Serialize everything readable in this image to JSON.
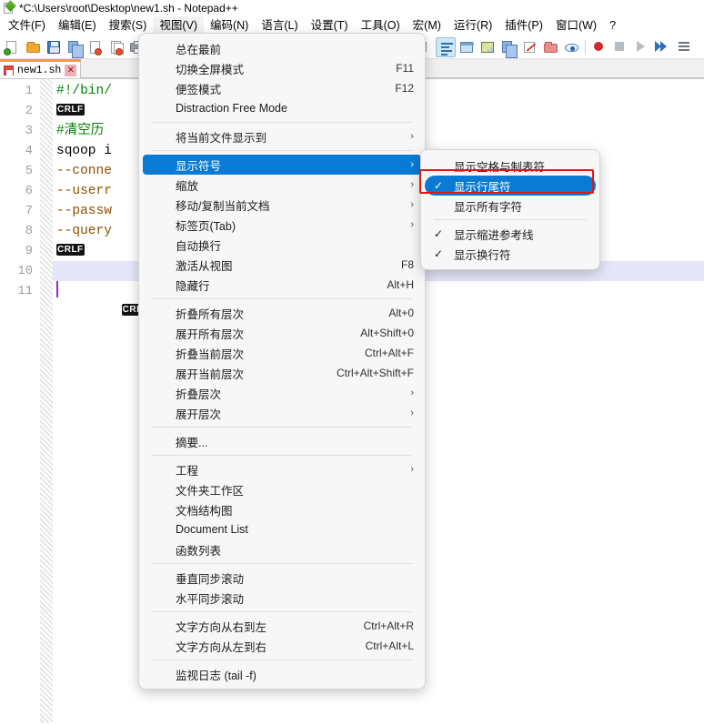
{
  "window": {
    "title": "*C:\\Users\\root\\Desktop\\new1.sh - Notepad++",
    "app_icon": "notepad-plus-plus-icon"
  },
  "menubar": {
    "items": [
      {
        "label": "文件(F)",
        "active": false
      },
      {
        "label": "编辑(E)",
        "active": false
      },
      {
        "label": "搜索(S)",
        "active": false
      },
      {
        "label": "视图(V)",
        "active": true
      },
      {
        "label": "编码(N)",
        "active": false
      },
      {
        "label": "语言(L)",
        "active": false
      },
      {
        "label": "设置(T)",
        "active": false
      },
      {
        "label": "工具(O)",
        "active": false
      },
      {
        "label": "宏(M)",
        "active": false
      },
      {
        "label": "运行(R)",
        "active": false
      },
      {
        "label": "插件(P)",
        "active": false
      },
      {
        "label": "窗口(W)",
        "active": false
      },
      {
        "label": "?",
        "active": false
      }
    ]
  },
  "toolbar": {
    "buttons": [
      "new-file-icon",
      "open-file-icon",
      "save-icon",
      "save-all-icon",
      "close-file-icon",
      "close-all-icon",
      "print-icon",
      "sep",
      "cut-icon",
      "copy-icon",
      "paste-icon",
      "sep",
      "undo-icon",
      "redo-icon",
      "sep",
      "find-icon",
      "replace-icon",
      "sep",
      "zoom-in-icon",
      "zoom-out-icon",
      "sep",
      "sync-scroll-icon",
      "word-wrap-icon",
      "show-all-chars-icon",
      "show-symbol-icon",
      "indent-guide-icon",
      "ui-map-icon",
      "clone-doc-icon",
      "marker-icon",
      "folder-as-workspace-icon",
      "monitor-icon",
      "sep",
      "record-macro-icon",
      "stop-macro-icon",
      "play-macro-icon",
      "run-macro-multi-icon",
      "run-icon"
    ],
    "active_button": "show-symbol-icon"
  },
  "tabs": {
    "items": [
      {
        "label": "new1.sh",
        "icon": "modified-file-icon",
        "close": "✕",
        "active": true
      }
    ]
  },
  "editor": {
    "line_numbers": [
      "1",
      "2",
      "3",
      "4",
      "5",
      "6",
      "7",
      "8",
      "9",
      "10",
      "11"
    ],
    "current_line": 10,
    "eol_marker": "CRLF",
    "lines": [
      {
        "n": 1,
        "segments": [
          {
            "text": "#!/bin/",
            "style": "comment"
          }
        ]
      },
      {
        "n": 2,
        "segments": [
          {
            "text": "",
            "style": "plain"
          }
        ],
        "eol": true
      },
      {
        "n": 3,
        "segments": [
          {
            "text": "#清空历",
            "style": "comment"
          }
        ]
      },
      {
        "n": 4,
        "segments": [
          {
            "text": "sqoop i",
            "style": "plain"
          }
        ]
      },
      {
        "n": 5,
        "segments": [
          {
            "text": "--conne",
            "style": "option"
          }
        ]
      },
      {
        "n": 6,
        "segments": [
          {
            "text": "--userr",
            "style": "option"
          }
        ]
      },
      {
        "n": 7,
        "segments": [
          {
            "text": "--passw",
            "style": "option"
          }
        ]
      },
      {
        "n": 8,
        "segments": [
          {
            "text": "--query",
            "style": "option"
          }
        ]
      },
      {
        "n": 9,
        "segments": [
          {
            "text": "",
            "style": "plain"
          }
        ],
        "eol": true
      },
      {
        "n": 10,
        "segments": [
          {
            "text": "",
            "style": "plain"
          }
        ],
        "eol": true
      },
      {
        "n": 11,
        "segments": [
          {
            "text": "",
            "style": "plain"
          }
        ]
      }
    ],
    "colors": {
      "comment": "#008000",
      "option": "#8f4f00",
      "plain": "#000000",
      "current_line_bg": "#e6e6fa",
      "caret": "#8b2fd6",
      "eol_bg": "#141414",
      "eol_fg": "#ffffff"
    }
  },
  "view_menu": {
    "items": [
      {
        "label": "总在最前",
        "accel": "",
        "chevron": false,
        "selected": false
      },
      {
        "label": "切换全屏模式",
        "accel": "F11",
        "chevron": false,
        "selected": false
      },
      {
        "label": "便签模式",
        "accel": "F12",
        "chevron": false,
        "selected": false
      },
      {
        "label": "Distraction Free Mode",
        "accel": "",
        "chevron": false,
        "selected": false
      },
      {
        "separator": true
      },
      {
        "label": "将当前文件显示到",
        "accel": "",
        "chevron": true,
        "selected": false
      },
      {
        "separator": true
      },
      {
        "label": "显示符号",
        "accel": "",
        "chevron": true,
        "selected": true
      },
      {
        "label": "缩放",
        "accel": "",
        "chevron": true,
        "selected": false
      },
      {
        "label": "移动/复制当前文档",
        "accel": "",
        "chevron": true,
        "selected": false
      },
      {
        "label": "标签页(Tab)",
        "accel": "",
        "chevron": true,
        "selected": false
      },
      {
        "label": "自动换行",
        "accel": "",
        "chevron": false,
        "selected": false
      },
      {
        "label": "激活从视图",
        "accel": "F8",
        "chevron": false,
        "selected": false
      },
      {
        "label": "隐藏行",
        "accel": "Alt+H",
        "chevron": false,
        "selected": false
      },
      {
        "separator": true
      },
      {
        "label": "折叠所有层次",
        "accel": "Alt+0",
        "chevron": false,
        "selected": false
      },
      {
        "label": "展开所有层次",
        "accel": "Alt+Shift+0",
        "chevron": false,
        "selected": false
      },
      {
        "label": "折叠当前层次",
        "accel": "Ctrl+Alt+F",
        "chevron": false,
        "selected": false
      },
      {
        "label": "展开当前层次",
        "accel": "Ctrl+Alt+Shift+F",
        "chevron": false,
        "selected": false
      },
      {
        "label": "折叠层次",
        "accel": "",
        "chevron": true,
        "selected": false
      },
      {
        "label": "展开层次",
        "accel": "",
        "chevron": true,
        "selected": false
      },
      {
        "separator": true
      },
      {
        "label": "摘要...",
        "accel": "",
        "chevron": false,
        "selected": false
      },
      {
        "separator": true
      },
      {
        "label": "工程",
        "accel": "",
        "chevron": true,
        "selected": false
      },
      {
        "label": "文件夹工作区",
        "accel": "",
        "chevron": false,
        "selected": false
      },
      {
        "label": "文档结构图",
        "accel": "",
        "chevron": false,
        "selected": false
      },
      {
        "label": "Document List",
        "accel": "",
        "chevron": false,
        "selected": false
      },
      {
        "label": "函数列表",
        "accel": "",
        "chevron": false,
        "selected": false
      },
      {
        "separator": true
      },
      {
        "label": "垂直同步滚动",
        "accel": "",
        "chevron": false,
        "selected": false
      },
      {
        "label": "水平同步滚动",
        "accel": "",
        "chevron": false,
        "selected": false
      },
      {
        "separator": true
      },
      {
        "label": "文字方向从右到左",
        "accel": "Ctrl+Alt+R",
        "chevron": false,
        "selected": false
      },
      {
        "label": "文字方向从左到右",
        "accel": "Ctrl+Alt+L",
        "chevron": false,
        "selected": false
      },
      {
        "separator": true
      },
      {
        "label": "监视日志 (tail -f)",
        "accel": "",
        "chevron": false,
        "selected": false
      }
    ]
  },
  "symbol_submenu": {
    "items": [
      {
        "label": "显示空格与制表符",
        "checked": false,
        "selected": false
      },
      {
        "label": "显示行尾符",
        "checked": true,
        "selected": true
      },
      {
        "label": "显示所有字符",
        "checked": false,
        "selected": false
      },
      {
        "separator": true
      },
      {
        "label": "显示缩进参考线",
        "checked": true,
        "selected": false
      },
      {
        "label": "显示换行符",
        "checked": true,
        "selected": false
      }
    ],
    "check_glyph": "✓",
    "highlight_color": "#0a7bd4",
    "annotation_box_color": "#e8150f"
  }
}
